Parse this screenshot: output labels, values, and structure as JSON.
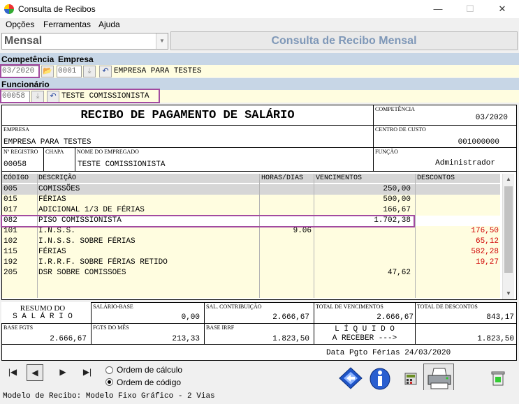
{
  "window": {
    "title": "Consulta de Recibos",
    "minimize": "—",
    "maximize": "☐",
    "close": "✕"
  },
  "menu": [
    "Opções",
    "Ferramentas",
    "Ajuda"
  ],
  "type_select": {
    "value": "Mensal"
  },
  "header_title": "Consulta de Recibo Mensal",
  "filters": {
    "competencia_label": "Competência",
    "empresa_label": "Empresa",
    "competencia_value": "03/2020",
    "empresa_code": "0001",
    "empresa_name": "EMPRESA PARA TESTES",
    "funcionario_label": "Funcionário",
    "funcionario_code": "00058",
    "funcionario_name": "TESTE COMISSIONISTA"
  },
  "receipt": {
    "title": "RECIBO DE PAGAMENTO DE SALÁRIO",
    "competencia_label": "COMPETÊNCIA",
    "competencia": "03/2020",
    "empresa_label": "EMPRESA",
    "empresa": "EMPRESA PARA TESTES",
    "centro_label": "CENTRO DE CUSTO",
    "centro": "001000000",
    "registro_label": "Nº REGISTRO",
    "registro": "00058",
    "chapa_label": "CHAPA",
    "nome_label": "NOME DO EMPREGADO",
    "nome": "TESTE COMISSIONISTA",
    "funcao_label": "FUNÇÃO",
    "funcao": "Administrador"
  },
  "table": {
    "headers": [
      "CÓDIGO",
      "DESCRIÇÃO",
      "HORAS/DIAS",
      "VENCIMENTOS",
      "DESCONTOS"
    ],
    "rows": [
      {
        "code": "005",
        "desc": "COMISSÕES",
        "hours": "",
        "venc": "250,00",
        "desc_val": ""
      },
      {
        "code": "015",
        "desc": "FÉRIAS",
        "hours": "",
        "venc": "500,00",
        "desc_val": ""
      },
      {
        "code": "017",
        "desc": "ADICIONAL 1/3 DE FÉRIAS",
        "hours": "",
        "venc": "166,67",
        "desc_val": ""
      },
      {
        "code": "082",
        "desc": "PISO COMISSIONISTA",
        "hours": "",
        "venc": "1.702,38",
        "desc_val": ""
      },
      {
        "code": "101",
        "desc": "I.N.S.S.",
        "hours": "9.06",
        "venc": "",
        "desc_val": "176,50"
      },
      {
        "code": "102",
        "desc": "I.N.S.S. SOBRE FÉRIAS",
        "hours": "",
        "venc": "",
        "desc_val": "65,12"
      },
      {
        "code": "115",
        "desc": "FÉRIAS",
        "hours": "",
        "venc": "",
        "desc_val": "582,28"
      },
      {
        "code": "192",
        "desc": "I.R.R.F. SOBRE FÉRIAS RETIDO",
        "hours": "",
        "venc": "",
        "desc_val": "19,27"
      },
      {
        "code": "205",
        "desc": "DSR SOBRE COMISSOES",
        "hours": "",
        "venc": "47,62",
        "desc_val": ""
      }
    ],
    "scroll_up": "▲",
    "scroll_down": "▼"
  },
  "summary": {
    "resumo_1": "RESUMO DO",
    "resumo_2": "S A L Á R I O",
    "salario_base_label": "SALÁRIO-BASE",
    "salario_base": "0,00",
    "sal_contrib_label": "SAL. CONTRIBUIÇÃO",
    "sal_contrib": "2.666,67",
    "total_venc_label": "TOTAL DE VENCIMENTOS",
    "total_venc": "2.666,67",
    "total_desc_label": "TOTAL DE DESCONTOS",
    "total_desc": "843,17",
    "base_fgts_label": "BASE FGTS",
    "base_fgts": "2.666,67",
    "fgts_mes_label": "FGTS DO MÊS",
    "fgts_mes": "213,33",
    "base_irrf_label": "BASE IRRF",
    "base_irrf": "1.823,50",
    "liquido_1": "L Í Q U I D O",
    "liquido_2": "A RECEBER --->",
    "liquido": "1.823,50",
    "data_pgto": "Data Pgto Férias 24/03/2020"
  },
  "nav": {
    "first": "|◀",
    "prev": "◀",
    "next": "▶",
    "last": "▶|"
  },
  "order": {
    "calc_label": "Ordem de cálculo",
    "code_label": "Ordem de código",
    "selected": "code"
  },
  "status": "Modelo de Recibo: Modelo Fixo Gráfico - 2 Vias",
  "colors": {
    "highlight": "#a24ba0",
    "bluebar": "#c7d6e6",
    "rowbg": "#fffde0",
    "negative": "#d00000"
  }
}
